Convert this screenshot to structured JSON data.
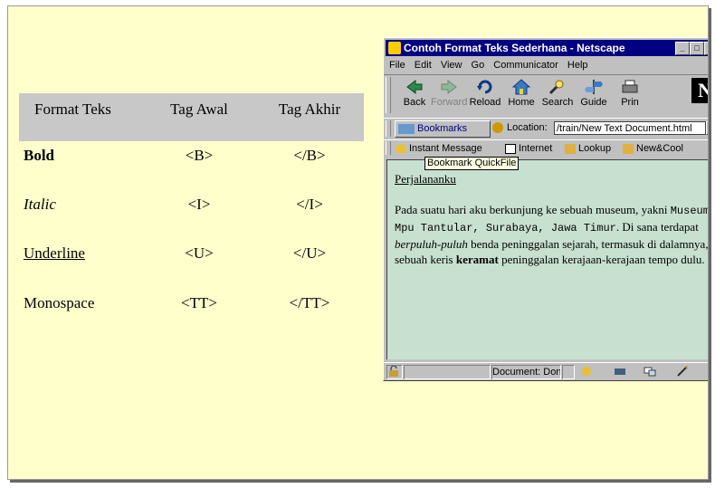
{
  "slide": {
    "headers": [
      "Format Teks",
      "Tag Awal",
      "Tag Akhir"
    ],
    "rows": [
      {
        "format": "Bold",
        "open": "<B>",
        "close": "</B>"
      },
      {
        "format": "Italic",
        "open": "<I>",
        "close": "</I>"
      },
      {
        "format": "Underline",
        "open": "<U>",
        "close": "</U>"
      },
      {
        "format": "Monospace",
        "open": "<TT>",
        "close": "</TT>"
      }
    ]
  },
  "window": {
    "title": "Contoh Format Teks Sederhana - Netscape",
    "menu": [
      "File",
      "Edit",
      "View",
      "Go",
      "Communicator",
      "Help"
    ],
    "nav": [
      "Back",
      "Forward",
      "Reload",
      "Home",
      "Search",
      "Guide",
      "Prin"
    ],
    "bookmarks_label": "Bookmarks",
    "location_label": "Location:",
    "location_value": "/train/New Text Document.html",
    "personal": [
      "Instant Message",
      "Internet",
      "Lookup",
      "New&Cool"
    ],
    "tooltip": "Bookmark QuickFile",
    "status": "Document: Done",
    "colors": {
      "titlebar": "#000080",
      "content_bg": "#c8e0d0",
      "slide_bg": "#ffffcc",
      "header_bg": "#c8c8c8"
    }
  },
  "page": {
    "heading": "Perjalananku",
    "p1": "Pada suatu hari aku berkunjung ke sebuah museum, yakni ",
    "p_mono": "Museum Mpu Tantular, Surabaya, Jawa Timur",
    "p2": ". Di sana terdapat ",
    "p_italic": "berpuluh-puluh",
    "p3": " benda peninggalan sejarah, termasuk di dalamnya, sebuah keris ",
    "p_bold": "keramat",
    "p4": " peninggalan kerajaan-kerajaan tempo dulu."
  }
}
